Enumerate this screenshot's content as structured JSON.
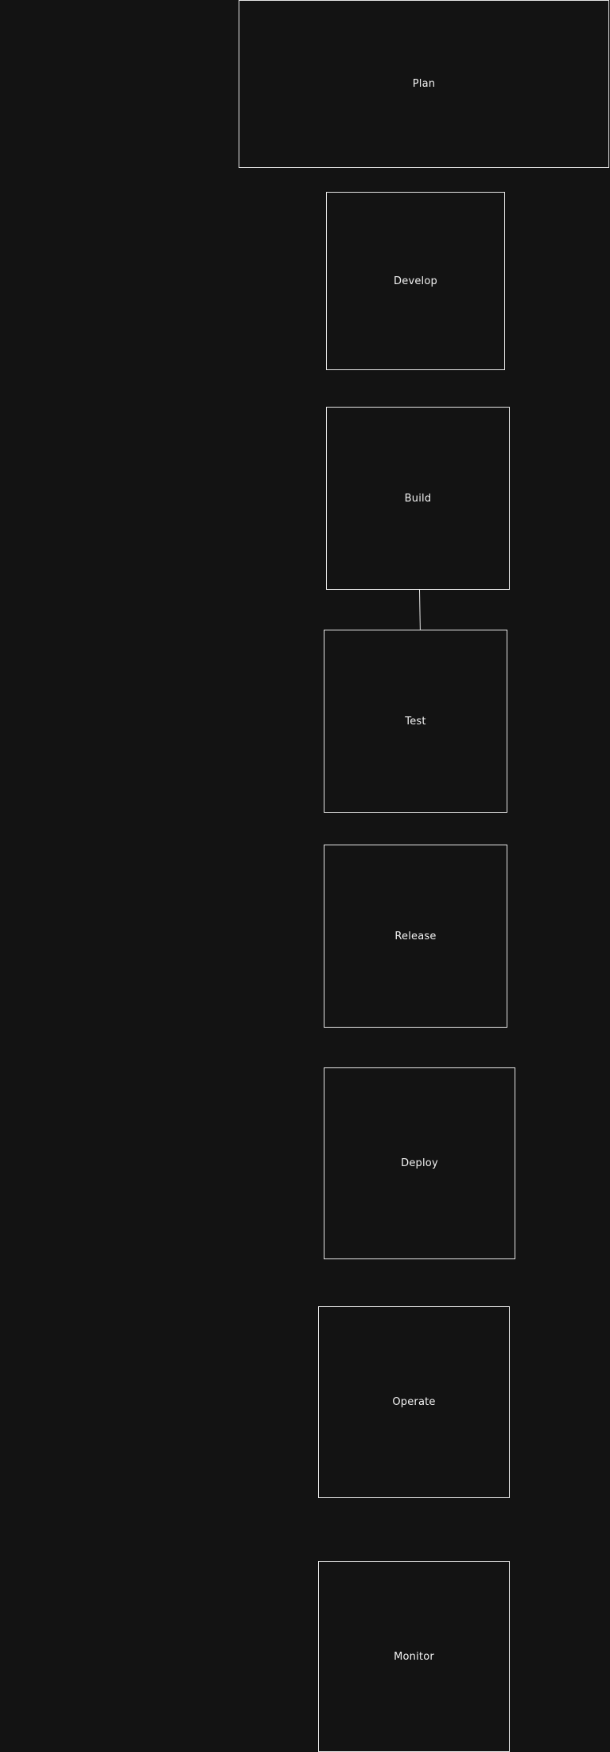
{
  "colors": {
    "background": "#131313",
    "stroke": "#e6e6e6",
    "text": "#f2f2f2"
  },
  "stages": [
    {
      "label": "Plan"
    },
    {
      "label": "Develop"
    },
    {
      "label": "Build"
    },
    {
      "label": "Test"
    },
    {
      "label": "Release"
    },
    {
      "label": "Deploy"
    },
    {
      "label": "Operate"
    },
    {
      "label": "Monitor"
    }
  ],
  "connections": [
    {
      "from": "Build",
      "to": "Test"
    }
  ]
}
